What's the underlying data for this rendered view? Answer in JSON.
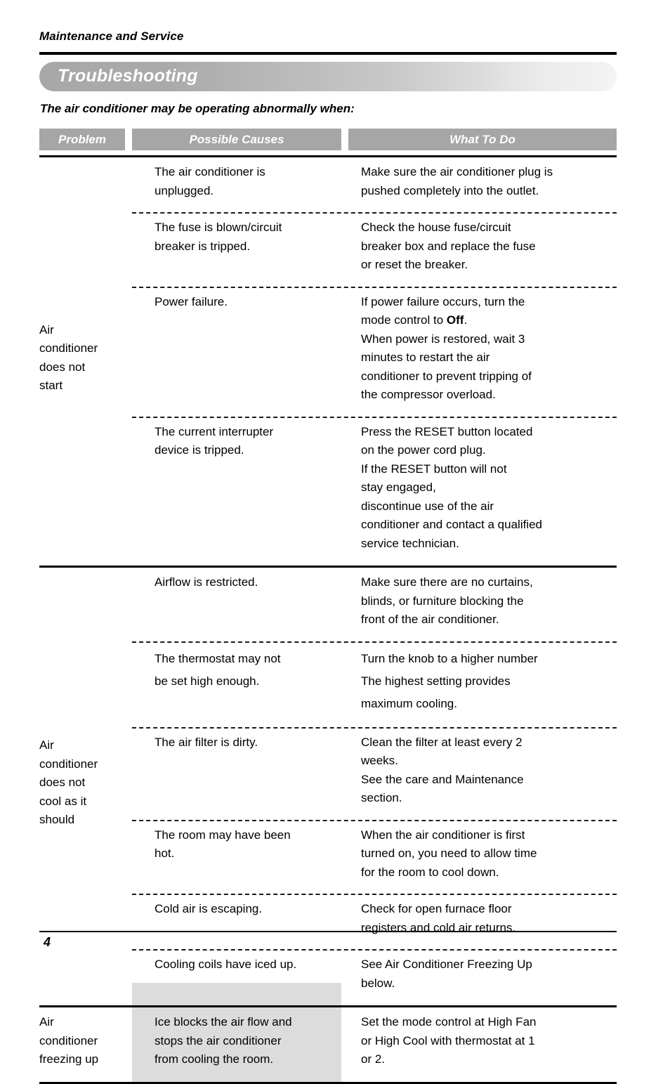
{
  "document": {
    "running_head": "Maintenance and Service",
    "banner_title": "Troubleshooting",
    "subtitle": "The air conditioner may be operating abnormally when:",
    "page_number": "4"
  },
  "colors": {
    "header_band_gray": "#A6A6A6",
    "cause_column_gray": "#DCDCDC",
    "banner_gradient_start": "#A8A8A8",
    "banner_gradient_end": "#F4F4F4",
    "rule_black": "#000000",
    "header_text_white": "#FFFFFF"
  },
  "table": {
    "columns": [
      {
        "key": "problem",
        "label": "Problem"
      },
      {
        "key": "causes",
        "label": "Possible Causes"
      },
      {
        "key": "whattodo",
        "label": "What To Do"
      }
    ],
    "groups": [
      {
        "problem": "Air\nconditioner\ndoes not\nstart",
        "rows": [
          {
            "cause": "The air conditioner is\nunplugged.",
            "action": "Make sure the air conditioner plug is\npushed completely into the outlet."
          },
          {
            "cause": "The fuse is blown/circuit\nbreaker is tripped.",
            "action": "Check the house fuse/circuit\nbreaker box and replace the fuse\nor reset the breaker."
          },
          {
            "cause": "Power failure.",
            "action_pre": "If power failure occurs, turn the\nmode control to ",
            "action_bold": "Off",
            "action_post": ".\nWhen power is restored, wait 3\nminutes to restart the air\nconditioner to prevent tripping of\nthe compressor overload."
          },
          {
            "cause": "The current interrupter\ndevice is tripped.",
            "action": "Press the RESET button located\non the power cord plug.\nIf the RESET button will not\nstay engaged,\ndiscontinue use of the air\nconditioner and contact a qualified\nservice technician."
          }
        ]
      },
      {
        "problem": "Air\nconditioner\ndoes not\ncool as it\nshould",
        "rows": [
          {
            "cause": "Airflow is restricted.",
            "action": "Make sure there are no curtains,\nblinds, or furniture blocking the\nfront of the air conditioner."
          },
          {
            "cause": "The thermostat may not\nbe set high enough.",
            "action": "Turn the knob to a higher number\nThe highest setting provides\nmaximum cooling."
          },
          {
            "cause": "The air filter is dirty.",
            "action": "Clean the filter at least every 2\nweeks.\nSee the care and Maintenance\nsection."
          },
          {
            "cause": "The room may have been\nhot.",
            "action": "When the air conditioner is first\nturned on, you need to allow time\nfor the room to cool down."
          },
          {
            "cause": "Cold air is escaping.",
            "action": "Check for open furnace floor\nregisters and cold air returns."
          },
          {
            "cause": "Cooling coils have iced up.",
            "action": "See Air Conditioner Freezing Up\nbelow."
          }
        ]
      },
      {
        "problem": "Air\nconditioner\nfreezing up",
        "rows": [
          {
            "cause": "Ice blocks the air flow and\nstops the air conditioner\nfrom cooling the room.",
            "action": "Set the mode control at High Fan\nor High Cool with thermostat at 1\nor 2."
          }
        ]
      }
    ]
  }
}
